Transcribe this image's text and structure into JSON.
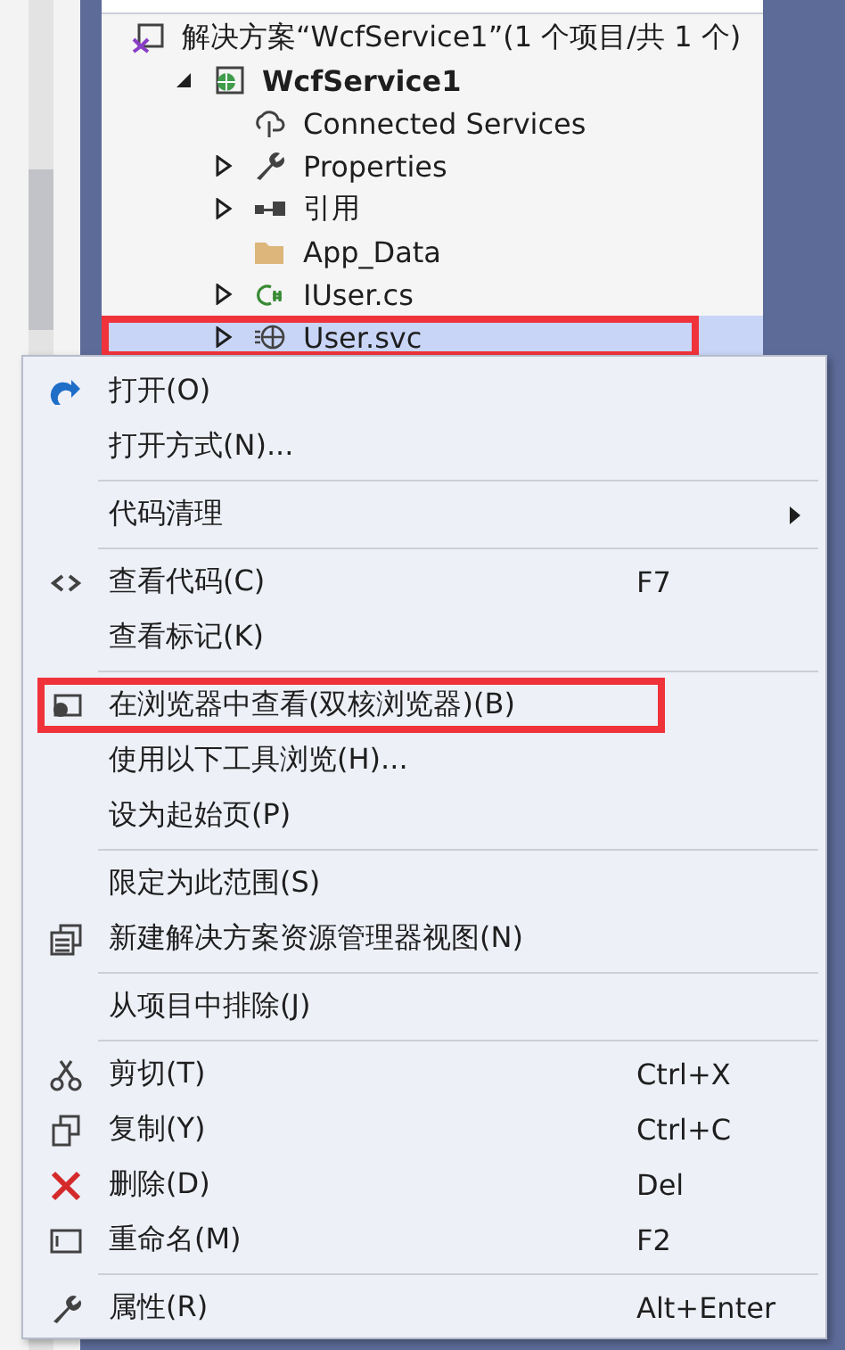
{
  "solution_explorer": {
    "tree": [
      {
        "label": "解决方案“WcfService1”(1 个项目/共 1 个)",
        "selected": false,
        "children": [
          {
            "label": "WcfService1",
            "bold": true,
            "expanded": true,
            "selected": false,
            "children": [
              {
                "label": "Connected Services",
                "selected": false
              },
              {
                "label": "Properties",
                "expanded": false,
                "selected": false
              },
              {
                "label": "引用",
                "expanded": false,
                "selected": false
              },
              {
                "label": "App_Data",
                "selected": false
              },
              {
                "label": "IUser.cs",
                "expanded": false,
                "selected": false
              },
              {
                "label": "User.svc",
                "expanded": false,
                "selected": true,
                "annotated": true
              }
            ]
          }
        ]
      }
    ]
  },
  "context_menu": {
    "items": [
      {
        "kind": "item",
        "label": "打开(O)"
      },
      {
        "kind": "item",
        "label": "打开方式(N)..."
      },
      {
        "kind": "separator"
      },
      {
        "kind": "item",
        "label": "代码清理",
        "submenu": true
      },
      {
        "kind": "separator"
      },
      {
        "kind": "item",
        "label": "查看代码(C)",
        "shortcut": "F7"
      },
      {
        "kind": "item",
        "label": "查看标记(K)"
      },
      {
        "kind": "separator"
      },
      {
        "kind": "item",
        "label": "在浏览器中查看(双核浏览器)(B)",
        "annotated": true
      },
      {
        "kind": "item",
        "label": "使用以下工具浏览(H)..."
      },
      {
        "kind": "item",
        "label": "设为起始页(P)"
      },
      {
        "kind": "separator"
      },
      {
        "kind": "item",
        "label": "限定为此范围(S)"
      },
      {
        "kind": "item",
        "label": "新建解决方案资源管理器视图(N)"
      },
      {
        "kind": "separator"
      },
      {
        "kind": "item",
        "label": "从项目中排除(J)"
      },
      {
        "kind": "separator"
      },
      {
        "kind": "item",
        "label": "剪切(T)",
        "shortcut": "Ctrl+X"
      },
      {
        "kind": "item",
        "label": "复制(Y)",
        "shortcut": "Ctrl+C"
      },
      {
        "kind": "item",
        "label": "删除(D)",
        "shortcut": "Del"
      },
      {
        "kind": "item",
        "label": "重命名(M)",
        "shortcut": "F2"
      },
      {
        "kind": "separator"
      },
      {
        "kind": "item",
        "label": "属性(R)",
        "shortcut": "Alt+Enter"
      }
    ]
  }
}
